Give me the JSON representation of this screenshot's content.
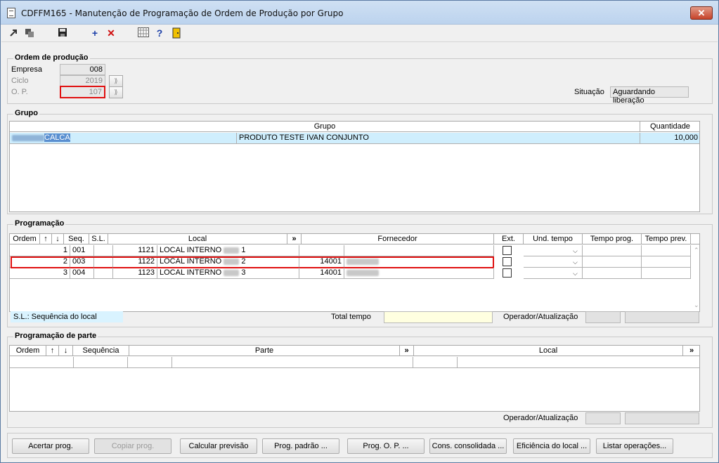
{
  "window": {
    "title": "CDFFM165 - Manutenção de Programação de Ordem de Produção por Grupo",
    "close_label": "✕"
  },
  "toolbar": {
    "icons": [
      "arrow-icon",
      "copy-icon",
      "save-icon",
      "plus-icon",
      "delete-icon",
      "calendar-icon",
      "help-icon",
      "exit-icon"
    ]
  },
  "ordem": {
    "title": "Ordem de produção",
    "empresa_label": "Empresa",
    "empresa_value": "008",
    "ciclo_label": "Ciclo",
    "ciclo_value": "2019",
    "op_label": "O. P.",
    "op_value": "107",
    "situacao_label": "Situação",
    "situacao_value": "Aguardando liberação"
  },
  "grupo": {
    "title": "Grupo",
    "headers": [
      "Grupo",
      "Quantidade"
    ],
    "rows": [
      {
        "code": "CALCA",
        "desc": "PRODUTO TESTE IVAN CONJUNTO",
        "qtd": "10,000"
      }
    ]
  },
  "programacao": {
    "title": "Programação",
    "headers": {
      "ordem": "Ordem",
      "up": "↑",
      "down": "↓",
      "seq": "Seq.",
      "sl": "S.L.",
      "local": "Local",
      "more": "»",
      "fornecedor": "Fornecedor",
      "ext": "Ext.",
      "und": "Und. tempo",
      "tprog": "Tempo prog.",
      "tprev": "Tempo prev."
    },
    "rows": [
      {
        "ordem": "1",
        "seq": "001",
        "sl": "",
        "local_code": "1121",
        "local_a": "LOCAL INTERNO",
        "local_b": "1",
        "forn_code": ""
      },
      {
        "ordem": "2",
        "seq": "003",
        "sl": "",
        "local_code": "1122",
        "local_a": "LOCAL INTERNO",
        "local_b": "2",
        "forn_code": "14001"
      },
      {
        "ordem": "3",
        "seq": "004",
        "sl": "",
        "local_code": "1123",
        "local_a": "LOCAL INTERNO",
        "local_b": "3",
        "forn_code": "14001"
      }
    ],
    "hint": "S.L.: Sequência do local",
    "total_label": "Total tempo",
    "operador_label": "Operador/Atualização"
  },
  "parte": {
    "title": "Programação de parte",
    "headers": {
      "ordem": "Ordem",
      "up": "↑",
      "down": "↓",
      "sequencia": "Sequência",
      "parte": "Parte",
      "more1": "»",
      "local": "Local",
      "more2": "»"
    },
    "operador_label": "Operador/Atualização"
  },
  "buttons": {
    "acertar": "Acertar prog.",
    "copiar": "Copiar prog.",
    "calcular": "Calcular previsão",
    "padrao": "Prog. padrão ...",
    "op": "Prog. O. P. ...",
    "cons": "Cons. consolidada ...",
    "eficiencia": "Eficiência do local ...",
    "listar": "Listar operações..."
  },
  "colors": {
    "highlight": "#e01010",
    "selection": "#cfeefd",
    "hint": "#d9f3ff",
    "total_field": "#ffffe0"
  }
}
